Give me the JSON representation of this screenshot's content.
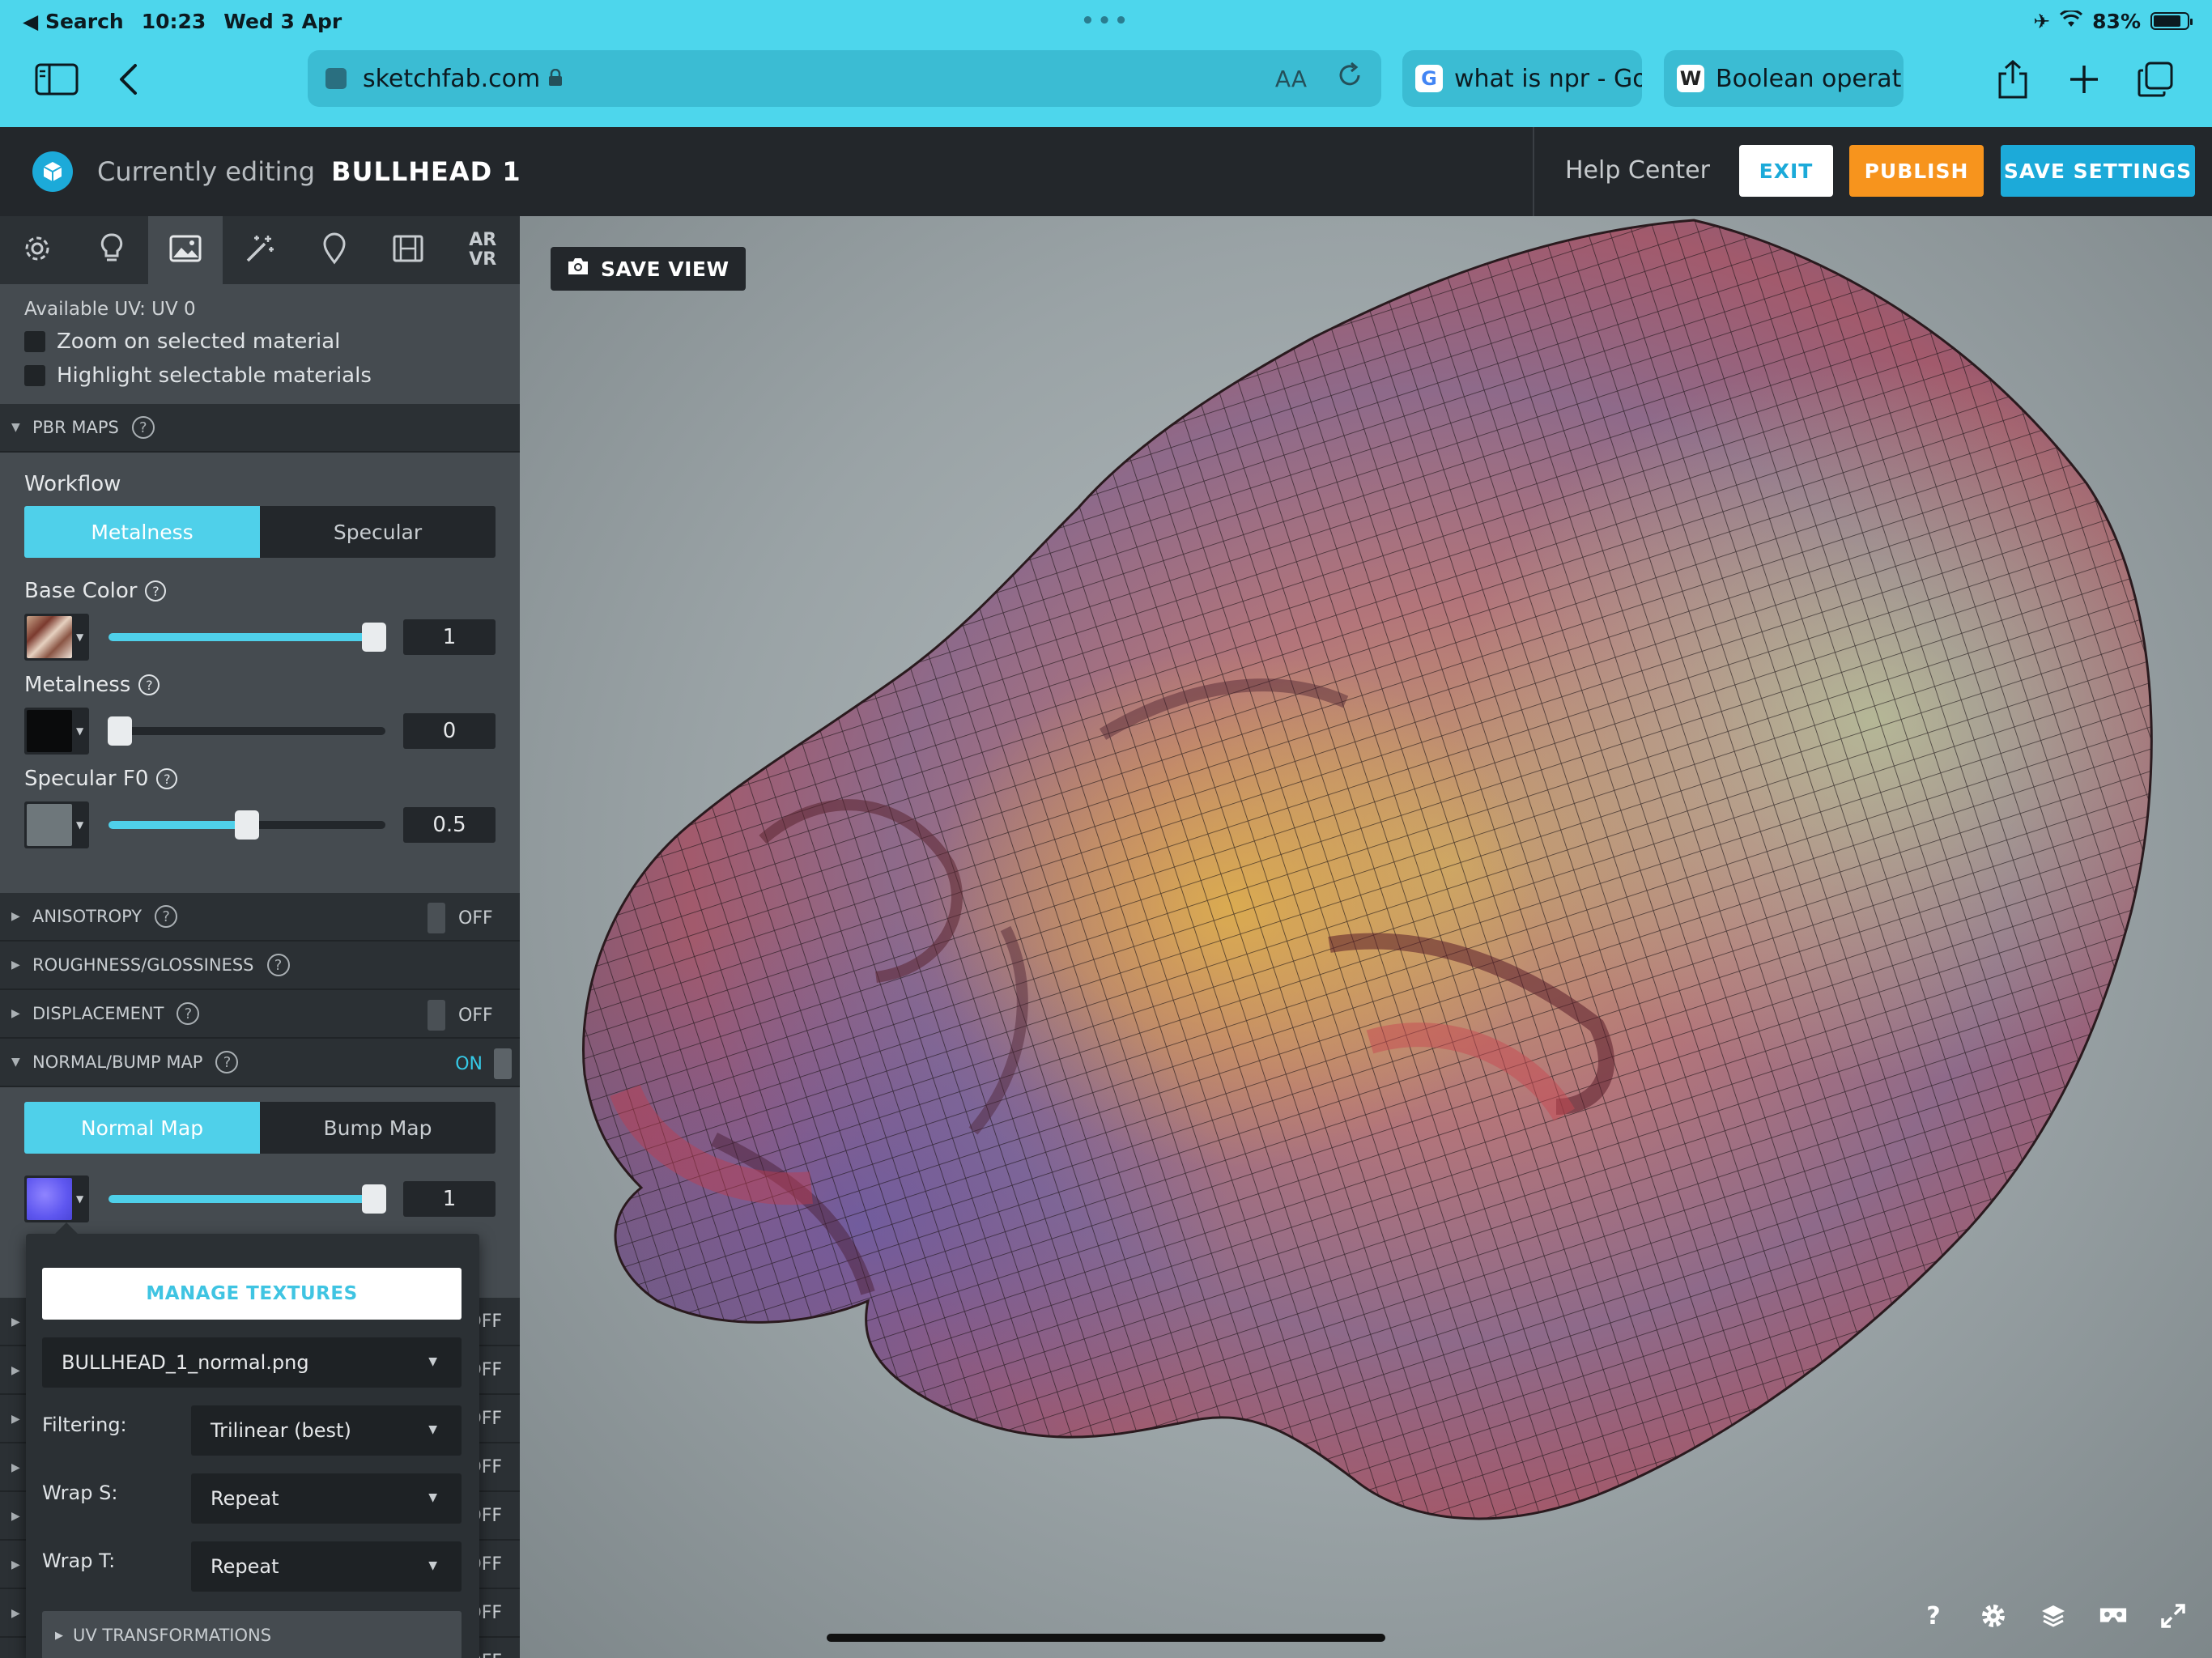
{
  "status_bar": {
    "back_app": "Search",
    "time": "10:23",
    "date": "Wed 3 Apr",
    "battery": "83%",
    "battery_level": 0.83
  },
  "safari": {
    "url": "sketchfab.com",
    "text_size_label": "AA",
    "tabs": [
      {
        "icon": "G",
        "title": "what is npr - Go"
      },
      {
        "icon": "W",
        "title": "Boolean operatio"
      }
    ]
  },
  "header": {
    "editing_label": "Currently editing",
    "model_name": "BULLHEAD 1",
    "help_center": "Help Center",
    "exit": "EXIT",
    "publish": "PUBLISH",
    "save_settings": "SAVE SETTINGS"
  },
  "sidebar": {
    "tabs": [
      "gear-icon",
      "bulb-icon",
      "image-icon",
      "wand-icon",
      "pin-icon",
      "film-icon",
      "ar-vr-icon"
    ],
    "ar_vr_label": [
      "AR",
      "VR"
    ],
    "available_uv": "Available UV: UV 0",
    "zoom_on_selected": "Zoom on selected material",
    "highlight_selectable": "Highlight selectable materials",
    "pbr_maps": {
      "title": "PBR MAPS",
      "workflow_label": "Workflow",
      "workflow_options": [
        "Metalness",
        "Specular"
      ],
      "workflow_selected": "Metalness",
      "base_color": {
        "label": "Base Color",
        "value": "1",
        "level": 1.0
      },
      "metalness": {
        "label": "Metalness",
        "value": "0",
        "level": 0.0
      },
      "specular_f0": {
        "label": "Specular F0",
        "value": "0.5",
        "level": 0.5
      }
    },
    "sections": {
      "anisotropy": {
        "label": "ANISOTROPY",
        "state": "OFF"
      },
      "roughness": {
        "label": "ROUGHNESS/GLOSSINESS"
      },
      "displacement": {
        "label": "DISPLACEMENT",
        "state": "OFF"
      },
      "normal_bump": {
        "label": "NORMAL/BUMP MAP",
        "state": "ON"
      }
    },
    "normal_map": {
      "options": [
        "Normal Map",
        "Bump Map"
      ],
      "selected": "Normal Map",
      "value": "1",
      "level": 1.0
    },
    "hidden_rows_state": "OFF"
  },
  "texture_popover": {
    "manage_textures": "MANAGE TEXTURES",
    "texture_file": "BULLHEAD_1_normal.png",
    "filtering_label": "Filtering:",
    "filtering_value": "Trilinear (best)",
    "wrap_s_label": "Wrap S:",
    "wrap_s_value": "Repeat",
    "wrap_t_label": "Wrap T:",
    "wrap_t_value": "Repeat",
    "uv_transformations": "UV TRANSFORMATIONS"
  },
  "viewport": {
    "save_view": "SAVE VIEW",
    "help_icon_label": "?"
  },
  "colors": {
    "safari_blue": "#4dd6ec",
    "accent": "#4fd0ea",
    "publish_orange": "#f7941d",
    "save_blue": "#1caad9"
  }
}
